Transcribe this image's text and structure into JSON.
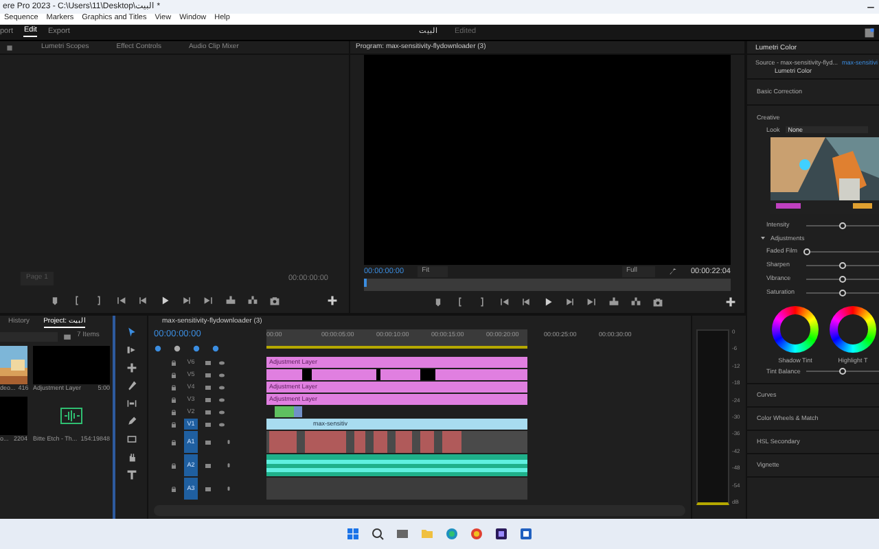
{
  "title_bar": {
    "title": "ere Pro 2023 - C:\\Users\\11\\Desktop\\البيت *"
  },
  "menu": [
    "Sequence",
    "Markers",
    "Graphics and Titles",
    "View",
    "Window",
    "Help"
  ],
  "workspaces": [
    {
      "label": "port",
      "selected": false
    },
    {
      "label": "Edit",
      "selected": true
    },
    {
      "label": "Export",
      "selected": false
    }
  ],
  "project_name": "البيت",
  "project_status": "Edited",
  "source_panel": {
    "tabs": [
      {
        "label": "Lumetri Scopes",
        "selected": false
      },
      {
        "label": "Effect Controls",
        "selected": false
      },
      {
        "label": "Audio Clip Mixer",
        "selected": false
      }
    ],
    "page": "Page 1",
    "timecode": "00:00:00:00"
  },
  "program": {
    "tab": "Program: max-sensitivity-flydownloader (3)",
    "timecode": "00:00:00:00",
    "zoom": "Fit",
    "quality": "Full",
    "duration": "00:00:22:04"
  },
  "project": {
    "tabs": [
      {
        "label": "History",
        "selected": false
      },
      {
        "label": "Project: البيت",
        "selected": true
      }
    ],
    "count": "7 Items",
    "items": [
      {
        "kind": "picture",
        "name": "deo...",
        "duration": "416"
      },
      {
        "kind": "black",
        "name": "Adjustment Layer",
        "duration": "5:00"
      },
      {
        "kind": "black",
        "name": "o...",
        "duration": "2204"
      },
      {
        "kind": "audio",
        "name": "Bitte Etch - Th...",
        "duration": "154:19848"
      }
    ]
  },
  "timeline": {
    "tab": "max-sensitivity-flydownloader (3)",
    "timecode": "00:00:00:00",
    "ruler": [
      "00:00",
      "00:00:05:00",
      "00:00:10:00",
      "00:00:15:00",
      "00:00:20:00",
      "00:00:25:00",
      "00:00:30:00"
    ],
    "tracks": [
      {
        "label": "V6",
        "targeted": false,
        "kind": "adjustment",
        "clip": "Adjustment Layer"
      },
      {
        "label": "V5",
        "targeted": false,
        "kind": "cuts"
      },
      {
        "label": "V4",
        "targeted": false,
        "kind": "adjustment",
        "clip": "Adjustment Layer"
      },
      {
        "label": "V3",
        "targeted": false,
        "kind": "adjustment",
        "clip": "Adjustment Layer"
      },
      {
        "label": "V2",
        "targeted": false,
        "kind": "mixed"
      },
      {
        "label": "V1",
        "targeted": true,
        "kind": "video",
        "clip": "max-sensitiv"
      },
      {
        "label": "A1",
        "targeted": true,
        "kind": "audio_red"
      },
      {
        "label": "A2",
        "targeted": true,
        "kind": "audio_wave"
      },
      {
        "label": "A3",
        "targeted": true,
        "kind": "empty"
      }
    ]
  },
  "meter_scale": [
    "0",
    "-6",
    "-12",
    "-18",
    "-24",
    "-30",
    "-36",
    "-42",
    "-48",
    "-54",
    "dB"
  ],
  "lumetri": {
    "tab": "Lumetri Color",
    "source": "Source - max-sensitivity-flyd...",
    "sequence": "max-sensitivi",
    "effect": "Lumetri Color",
    "sections_top": [
      "Basic Correction",
      "Creative"
    ],
    "look_label": "Look",
    "look": "None",
    "intensity": {
      "label": "Intensity",
      "level": 0.5
    },
    "adjustments": "Adjustments",
    "adjust_expanded": true,
    "sliders": [
      {
        "label": "Faded Film",
        "level": 0
      },
      {
        "label": "Sharpen",
        "level": 0.5
      },
      {
        "label": "Vibrance",
        "level": 0.5
      },
      {
        "label": "Saturation",
        "level": 0.5
      }
    ],
    "wheels": [
      "Shadow Tint",
      "Highlight T"
    ],
    "tint": {
      "label": "Tint Balance",
      "level": 0.5
    },
    "sections": [
      "Curves",
      "Color Wheels & Match",
      "HSL Secondary",
      "Vignette"
    ]
  }
}
